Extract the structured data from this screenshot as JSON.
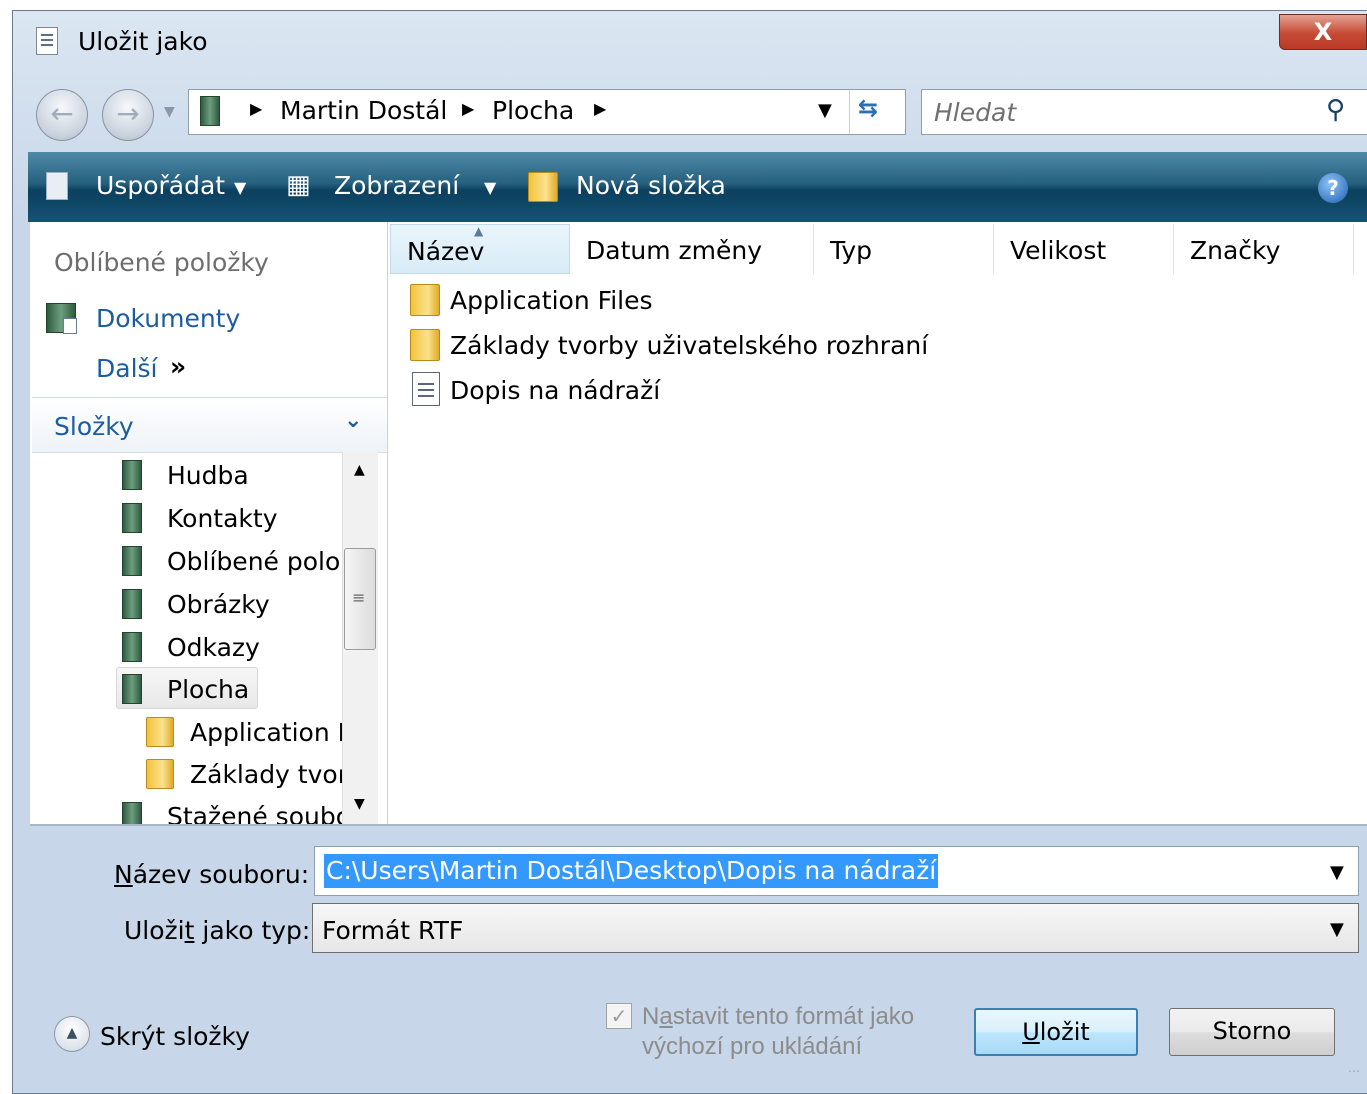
{
  "window": {
    "title": "Uložit jako",
    "close_label": "X"
  },
  "navigation": {
    "breadcrumb": [
      "Martin Dostál",
      "Plocha"
    ],
    "search_placeholder": "Hledat"
  },
  "toolbar": {
    "organize_label": "Uspořádat",
    "views_label": "Zobrazení",
    "new_folder_label": "Nová složka",
    "help_label": "?"
  },
  "favorites": {
    "header": "Oblíbené položky",
    "items": [
      {
        "label": "Dokumenty",
        "icon": "documents-library-icon"
      }
    ],
    "more_label": "Další",
    "more_arrows": "»"
  },
  "folders": {
    "header": "Složky",
    "tree": [
      {
        "label": "Hudba",
        "icon": "music-library-icon"
      },
      {
        "label": "Kontakty",
        "icon": "contacts-library-icon"
      },
      {
        "label": "Oblíbené polo:",
        "icon": "favorites-library-icon"
      },
      {
        "label": "Obrázky",
        "icon": "pictures-library-icon"
      },
      {
        "label": "Odkazy",
        "icon": "links-library-icon"
      },
      {
        "label": "Plocha",
        "icon": "desktop-library-icon",
        "selected": true
      },
      {
        "label": "Application F",
        "icon": "folder-icon"
      },
      {
        "label": "Základy tvorl",
        "icon": "folder-icon"
      },
      {
        "label": "Stažené soubo",
        "icon": "downloads-library-icon"
      }
    ]
  },
  "file_list": {
    "columns": [
      "Název",
      "Datum změny",
      "Typ",
      "Velikost",
      "Značky"
    ],
    "sort_column": "Název",
    "items": [
      {
        "name": "Application Files",
        "icon": "folder-icon"
      },
      {
        "name": "Základy tvorby uživatelského rozhraní",
        "icon": "folder-icon"
      },
      {
        "name": "Dopis na nádraží",
        "icon": "rtf-document-icon"
      }
    ]
  },
  "form": {
    "filename_label_access": "N",
    "filename_label_rest": "ázev souboru:",
    "filename_value": "C:\\Users\\Martin Dostál\\Desktop\\Dopis na nádraží",
    "filetype_label_pre": "Uloži",
    "filetype_label_access": "t",
    "filetype_label_post": " jako typ:",
    "filetype_value": "Formát RTF"
  },
  "footer": {
    "hide_folders_label": "Skrýt složky",
    "default_format_line1_pre": "N",
    "default_format_line1_access": "a",
    "default_format_line1_post": "stavit tento formát jako",
    "default_format_line2": "výchozí pro ukládání",
    "default_format_checked": true,
    "save_access": "U",
    "save_rest": "ložit",
    "cancel_label": "Storno"
  }
}
